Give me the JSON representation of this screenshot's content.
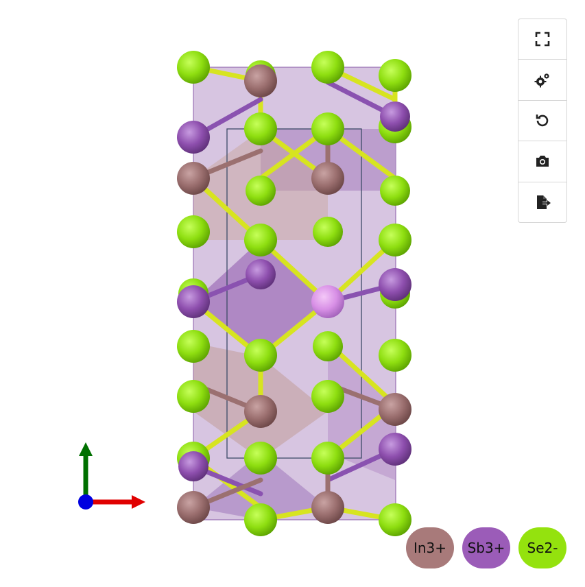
{
  "toolbar": {
    "buttons": [
      {
        "icon": "fullscreen-icon"
      },
      {
        "icon": "settings-gears-icon"
      },
      {
        "icon": "reset-rotation-icon"
      },
      {
        "icon": "camera-icon"
      },
      {
        "icon": "export-file-icon"
      }
    ]
  },
  "legend": {
    "items": [
      {
        "label": "In3+",
        "color": "#a87a7a"
      },
      {
        "label": "Sb3+",
        "color": "#9b5cb8"
      },
      {
        "label": "Se2-",
        "color": "#94e20e"
      }
    ]
  },
  "axes": {
    "x_color": "#e00000",
    "y_color": "#007000",
    "z_color": "#0000e0"
  }
}
